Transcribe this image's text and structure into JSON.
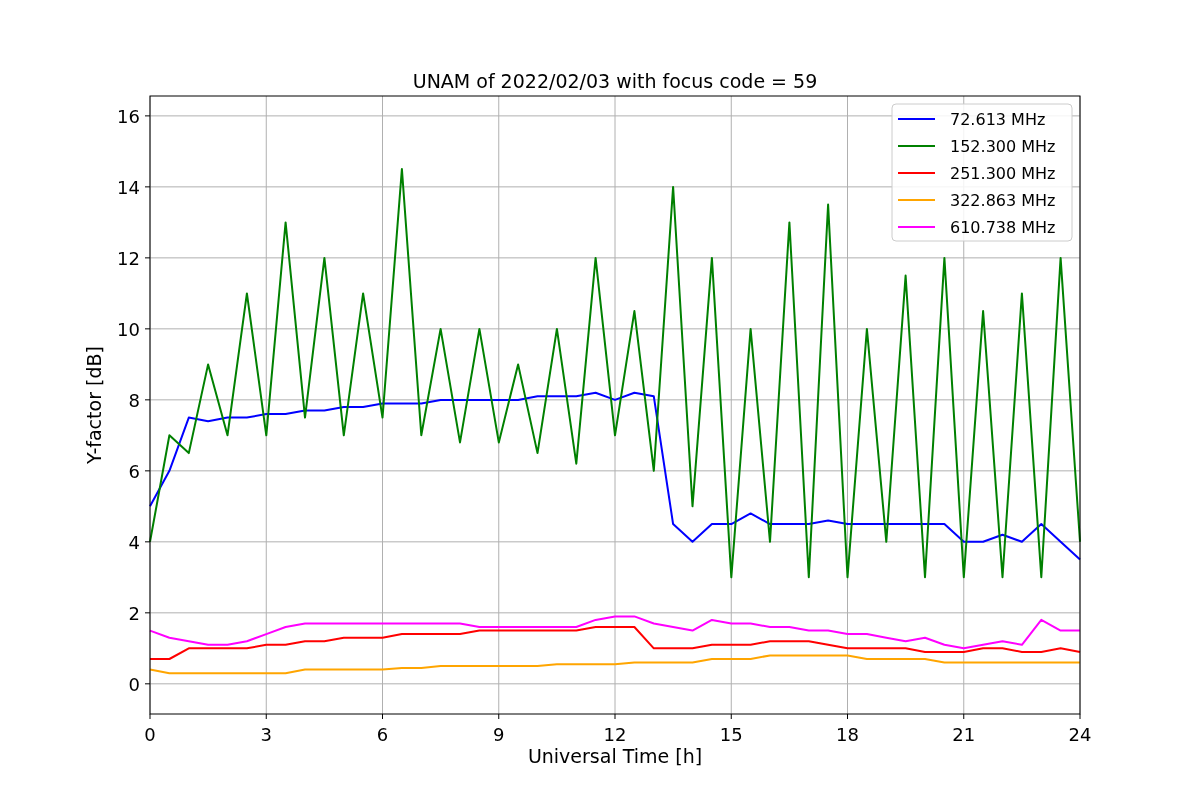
{
  "chart_data": {
    "type": "line",
    "title": "UNAM of 2022/02/03 with focus code = 59",
    "xlabel": "Universal Time [h]",
    "ylabel": "Y-factor [dB]",
    "x": [
      0,
      0.5,
      1,
      1.5,
      2,
      2.5,
      3,
      3.5,
      4,
      4.5,
      5,
      5.5,
      6,
      6.5,
      7,
      7.5,
      8,
      8.5,
      9,
      9.5,
      10,
      10.5,
      11,
      11.5,
      12,
      12.5,
      13,
      13.5,
      14,
      14.5,
      15,
      15.5,
      16,
      16.5,
      17,
      17.5,
      18,
      18.5,
      19,
      19.5,
      20,
      20.5,
      21,
      21.5,
      22,
      22.5,
      23,
      23.5,
      24
    ],
    "series": [
      {
        "name": "72.613 MHz",
        "color": "#0000ff",
        "values": [
          5,
          6,
          7.5,
          7.4,
          7.5,
          7.5,
          7.6,
          7.6,
          7.7,
          7.7,
          7.8,
          7.8,
          7.9,
          7.9,
          7.9,
          8,
          8,
          8,
          8,
          8,
          8.1,
          8.1,
          8.1,
          8.2,
          8,
          8.2,
          8.1,
          4.5,
          4,
          4.5,
          4.5,
          4.8,
          4.5,
          4.5,
          4.5,
          4.6,
          4.5,
          4.5,
          4.5,
          4.5,
          4.5,
          4.5,
          4,
          4,
          4.2,
          4,
          4.5,
          4,
          3.5
        ]
      },
      {
        "name": "152.300 MHz",
        "color": "#008000",
        "values": [
          4,
          7,
          6.5,
          9,
          7,
          11,
          7,
          13,
          7.5,
          12,
          7,
          11,
          7.5,
          14.5,
          7,
          10,
          6.8,
          10,
          6.8,
          9,
          6.5,
          10,
          6.2,
          12,
          7,
          10.5,
          6,
          14,
          5,
          12,
          3,
          10,
          4,
          13,
          3,
          13.5,
          3,
          10,
          4,
          11.5,
          3,
          12,
          3,
          10.5,
          3,
          11,
          3,
          12,
          4
        ]
      },
      {
        "name": "251.300 MHz",
        "color": "#ff0000",
        "values": [
          0.7,
          0.7,
          1.0,
          1.0,
          1.0,
          1.0,
          1.1,
          1.1,
          1.2,
          1.2,
          1.3,
          1.3,
          1.3,
          1.4,
          1.4,
          1.4,
          1.4,
          1.5,
          1.5,
          1.5,
          1.5,
          1.5,
          1.5,
          1.6,
          1.6,
          1.6,
          1.0,
          1.0,
          1.0,
          1.1,
          1.1,
          1.1,
          1.2,
          1.2,
          1.2,
          1.1,
          1.0,
          1.0,
          1.0,
          1.0,
          0.9,
          0.9,
          0.9,
          1.0,
          1.0,
          0.9,
          0.9,
          1.0,
          0.9
        ]
      },
      {
        "name": "322.863 MHz",
        "color": "#ffa500",
        "values": [
          0.4,
          0.3,
          0.3,
          0.3,
          0.3,
          0.3,
          0.3,
          0.3,
          0.4,
          0.4,
          0.4,
          0.4,
          0.4,
          0.45,
          0.45,
          0.5,
          0.5,
          0.5,
          0.5,
          0.5,
          0.5,
          0.55,
          0.55,
          0.55,
          0.55,
          0.6,
          0.6,
          0.6,
          0.6,
          0.7,
          0.7,
          0.7,
          0.8,
          0.8,
          0.8,
          0.8,
          0.8,
          0.7,
          0.7,
          0.7,
          0.7,
          0.6,
          0.6,
          0.6,
          0.6,
          0.6,
          0.6,
          0.6,
          0.6
        ]
      },
      {
        "name": "610.738 MHz",
        "color": "#ff00ff",
        "values": [
          1.5,
          1.3,
          1.2,
          1.1,
          1.1,
          1.2,
          1.4,
          1.6,
          1.7,
          1.7,
          1.7,
          1.7,
          1.7,
          1.7,
          1.7,
          1.7,
          1.7,
          1.6,
          1.6,
          1.6,
          1.6,
          1.6,
          1.6,
          1.8,
          1.9,
          1.9,
          1.7,
          1.6,
          1.5,
          1.8,
          1.7,
          1.7,
          1.6,
          1.6,
          1.5,
          1.5,
          1.4,
          1.4,
          1.3,
          1.2,
          1.3,
          1.1,
          1.0,
          1.1,
          1.2,
          1.1,
          1.8,
          1.5,
          1.5
        ]
      }
    ],
    "xlim": [
      0,
      24
    ],
    "ylim": [
      -0.85,
      16.56
    ],
    "xticks": [
      0,
      3,
      6,
      9,
      12,
      15,
      18,
      21,
      24
    ],
    "yticks": [
      0,
      2,
      4,
      6,
      8,
      10,
      12,
      14,
      16
    ],
    "grid": true,
    "legend": true
  }
}
